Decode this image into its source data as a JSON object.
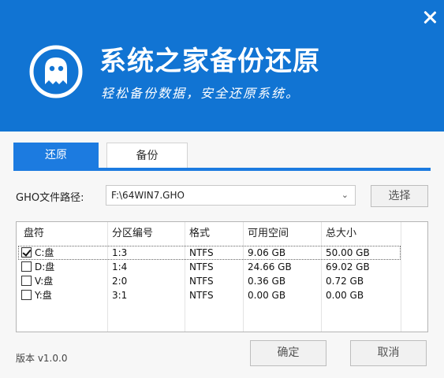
{
  "header": {
    "title": "系统之家备份还原",
    "subtitle": "轻松备份数据，安全还原系统。"
  },
  "tabs": [
    {
      "label": "还原",
      "active": true
    },
    {
      "label": "备份",
      "active": false
    }
  ],
  "gho": {
    "label": "GHO文件路径:",
    "value": "F:\\64WIN7.GHO",
    "browse_label": "选择"
  },
  "table": {
    "headers": [
      "盘符",
      "分区编号",
      "格式",
      "可用空间",
      "总大小"
    ],
    "rows": [
      {
        "drive": "C:盘",
        "partition": "1:3",
        "format": "NTFS",
        "free": "9.06 GB",
        "total": "50.00 GB",
        "checked": true
      },
      {
        "drive": "D:盘",
        "partition": "1:4",
        "format": "NTFS",
        "free": "24.66 GB",
        "total": "69.02 GB",
        "checked": false
      },
      {
        "drive": "V:盘",
        "partition": "2:0",
        "format": "NTFS",
        "free": "0.36 GB",
        "total": "0.72 GB",
        "checked": false
      },
      {
        "drive": "Y:盘",
        "partition": "3:1",
        "format": "NTFS",
        "free": "0.00 GB",
        "total": "0.00 GB",
        "checked": false
      }
    ]
  },
  "footer": {
    "version": "版本 v1.0.0",
    "ok_label": "确定",
    "cancel_label": "取消"
  },
  "colors": {
    "header_bg": "#1174d3",
    "accent": "#1c7be0"
  },
  "icons": [
    "ghost-logo-icon",
    "close-icon",
    "chevron-down-icon",
    "checkbox-icon"
  ]
}
